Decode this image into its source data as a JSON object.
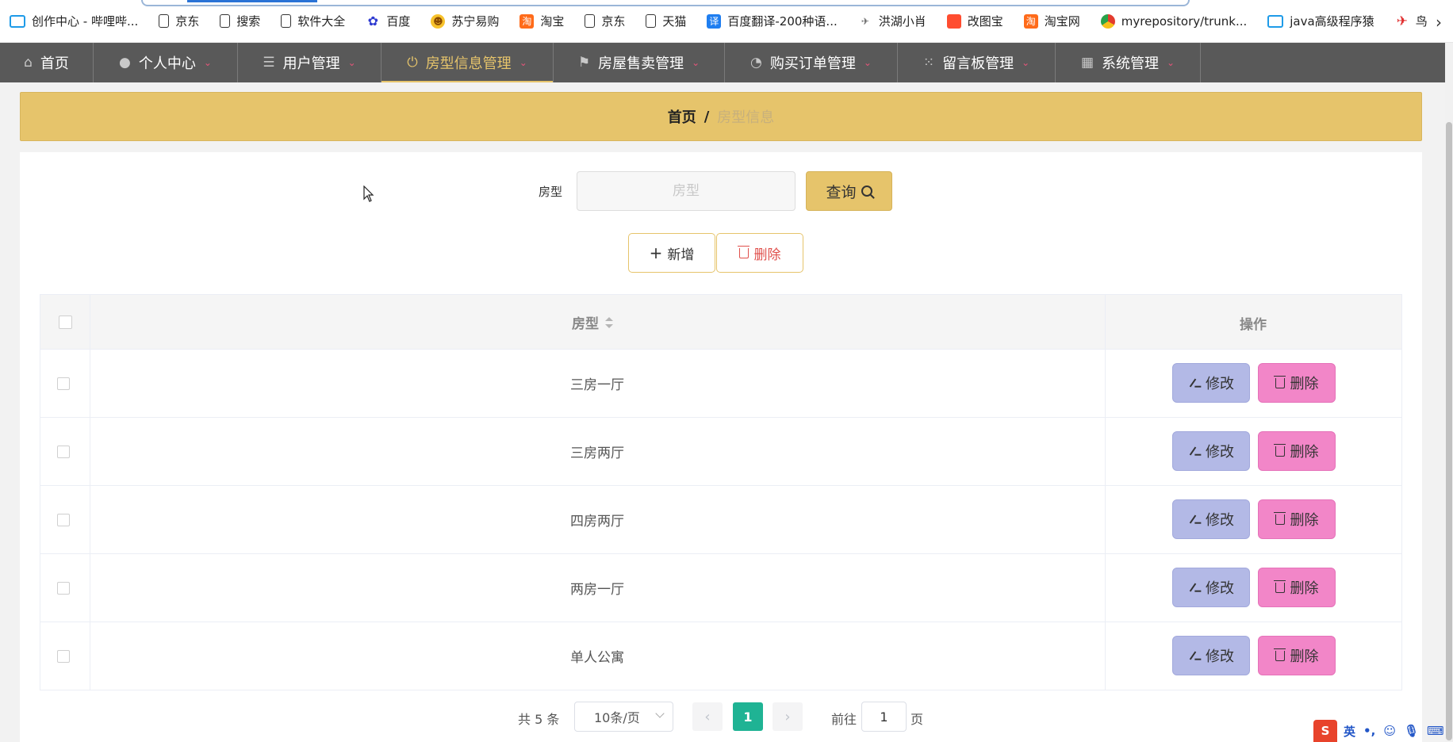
{
  "bookmarks": [
    {
      "label": "创作中心 - 哔哩哔...",
      "icon": "bilibili-icon"
    },
    {
      "label": "京东",
      "icon": "page-icon"
    },
    {
      "label": "搜索",
      "icon": "page-icon"
    },
    {
      "label": "软件大全",
      "icon": "page-icon"
    },
    {
      "label": "百度",
      "icon": "baidu-icon"
    },
    {
      "label": "苏宁易购",
      "icon": "suning-icon"
    },
    {
      "label": "淘宝",
      "icon": "taobao-icon"
    },
    {
      "label": "京东",
      "icon": "page-icon"
    },
    {
      "label": "天猫",
      "icon": "page-icon"
    },
    {
      "label": "百度翻译-200种语...",
      "icon": "translate-icon"
    },
    {
      "label": "洪湖小肖",
      "icon": "bird-icon"
    },
    {
      "label": "改图宝",
      "icon": "gaitubao-icon"
    },
    {
      "label": "淘宝网",
      "icon": "taobao-icon"
    },
    {
      "label": "myrepository/trunk...",
      "icon": "chrome-icon"
    },
    {
      "label": "java高级程序猿",
      "icon": "bilibili-icon"
    },
    {
      "label": "鸟",
      "icon": "bird-icon"
    }
  ],
  "bookmarks_more": "›",
  "nav": [
    {
      "label": "首页",
      "icon": "home-icon",
      "glyph": "⌂",
      "caret": false,
      "width": 118
    },
    {
      "label": "个人中心",
      "icon": "user-icon",
      "glyph": "●",
      "caret": true,
      "width": 182
    },
    {
      "label": "用户管理",
      "icon": "list-icon",
      "glyph": "☰",
      "caret": true,
      "width": 181
    },
    {
      "label": "房型信息管理",
      "icon": "power-icon",
      "glyph": "⏻",
      "caret": true,
      "width": 217,
      "active": true
    },
    {
      "label": "房屋售卖管理",
      "icon": "flag-icon",
      "glyph": "⚑",
      "caret": true,
      "width": 216
    },
    {
      "label": "购买订单管理",
      "icon": "gauge-icon",
      "glyph": "◔",
      "caret": true,
      "width": 218
    },
    {
      "label": "留言板管理",
      "icon": "grid-icon",
      "glyph": "⁙",
      "caret": true,
      "width": 199
    },
    {
      "label": "系统管理",
      "icon": "apps-icon",
      "glyph": "▦",
      "caret": true,
      "width": 183
    }
  ],
  "breadcrumb": {
    "home": "首页",
    "sep": "/",
    "current": "房型信息"
  },
  "search": {
    "label": "房型",
    "placeholder": "房型",
    "value": "",
    "button": "查询"
  },
  "actions": {
    "add": "新增",
    "delete": "删除"
  },
  "table": {
    "headers": {
      "type": "房型",
      "ops": "操作"
    },
    "rows": [
      "三房一厅",
      "三房两厅",
      "四房两厅",
      "两房一厅",
      "单人公寓"
    ],
    "edit_label": "修改",
    "delete_label": "删除"
  },
  "pagination": {
    "total": "共 5 条",
    "page_size": "10条/页",
    "prev": "‹",
    "current": "1",
    "next": "›",
    "goto_label": "前往",
    "goto_value": "1",
    "page_label": "页"
  },
  "ime": {
    "logo": "S",
    "items": [
      "英",
      "•,",
      "☺",
      "🎙",
      "⌨"
    ]
  },
  "colors": {
    "nav_bg": "#595959",
    "accent": "#e6c46b",
    "edit_btn": "#b3b9e6",
    "delete_btn": "#f286c8",
    "page_active": "#1fb394"
  }
}
